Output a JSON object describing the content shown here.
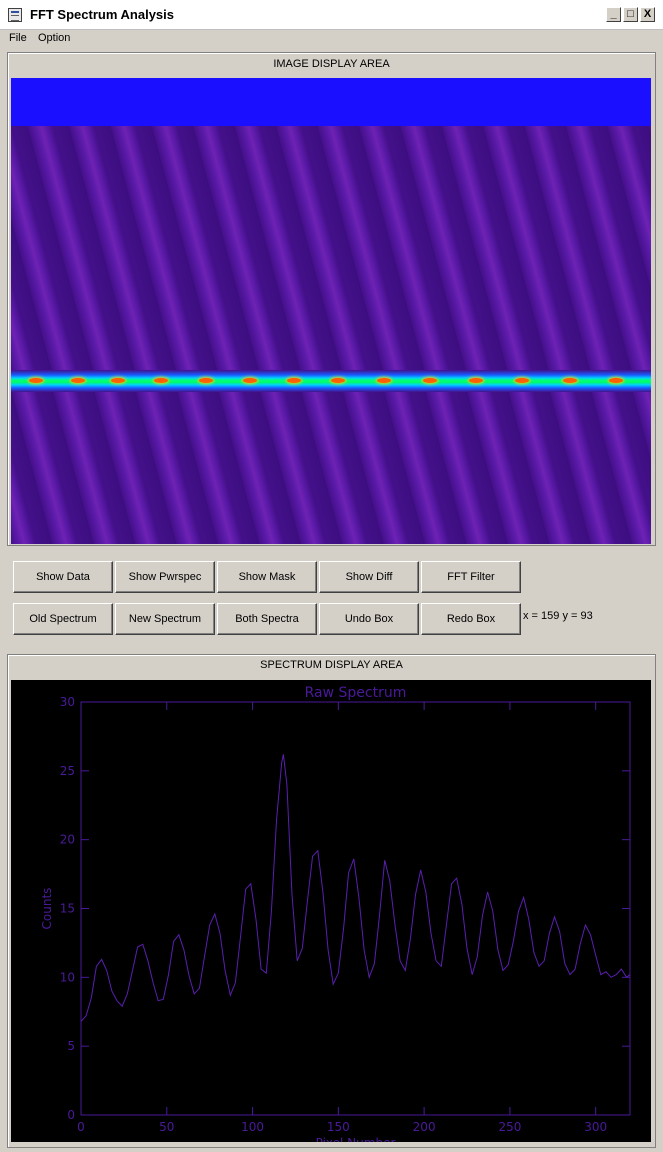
{
  "window": {
    "title": "FFT Spectrum Analysis",
    "minimize": "_",
    "maximize": "□",
    "close": "X"
  },
  "menu": [
    "File",
    "Option"
  ],
  "image_area": {
    "label": "IMAGE DISPLAY AREA"
  },
  "buttons_row1": [
    "Show Data",
    "Show Pwrspec",
    "Show Mask",
    "Show Diff",
    "FFT Filter"
  ],
  "buttons_row2": [
    "Old Spectrum",
    "New Spectrum",
    "Both Spectra",
    "Undo Box",
    "Redo Box"
  ],
  "cursor_readout": "x = 159 y =  93",
  "spectrum_area": {
    "label": "SPECTRUM DISPLAY AREA"
  },
  "colors": {
    "plot_line": "#5a1fb0",
    "plot_bg": "#000000",
    "axis": "#4a1a9a"
  },
  "chart_data": {
    "type": "line",
    "title": "Raw Spectrum",
    "xlabel": "Pixel Number",
    "ylabel": "Counts",
    "xlim": [
      0,
      320
    ],
    "ylim": [
      0,
      30
    ],
    "xticks": [
      0,
      50,
      100,
      150,
      200,
      250,
      300
    ],
    "yticks": [
      0,
      5,
      10,
      15,
      20,
      25,
      30
    ],
    "grid": false,
    "x": [
      0,
      3,
      6,
      9,
      12,
      15,
      18,
      21,
      24,
      27,
      30,
      33,
      36,
      39,
      42,
      45,
      48,
      51,
      54,
      57,
      60,
      63,
      66,
      69,
      72,
      75,
      78,
      81,
      84,
      87,
      90,
      93,
      96,
      99,
      102,
      105,
      108,
      111,
      114,
      117,
      118,
      120,
      123,
      126,
      129,
      132,
      135,
      138,
      141,
      144,
      147,
      150,
      153,
      156,
      159,
      162,
      165,
      168,
      171,
      174,
      177,
      180,
      183,
      186,
      189,
      192,
      195,
      198,
      201,
      204,
      207,
      210,
      213,
      216,
      219,
      222,
      225,
      228,
      231,
      234,
      237,
      240,
      243,
      246,
      249,
      252,
      255,
      258,
      261,
      264,
      267,
      270,
      273,
      276,
      279,
      282,
      285,
      288,
      291,
      294,
      297,
      300,
      303,
      306,
      309,
      312,
      315,
      318,
      320
    ],
    "y": [
      6.8,
      7.2,
      8.5,
      10.8,
      11.3,
      10.5,
      9.0,
      8.3,
      7.9,
      8.8,
      10.5,
      12.2,
      12.4,
      11.2,
      9.6,
      8.3,
      8.4,
      10.2,
      12.6,
      13.1,
      12.0,
      10.1,
      8.8,
      9.2,
      11.5,
      13.8,
      14.6,
      13.2,
      10.5,
      8.7,
      9.6,
      13.0,
      16.4,
      16.8,
      14.2,
      10.6,
      10.3,
      14.8,
      21.5,
      25.6,
      26.2,
      24.0,
      16.0,
      11.2,
      12.1,
      15.6,
      18.8,
      19.2,
      16.2,
      12.0,
      9.5,
      10.3,
      13.5,
      17.6,
      18.6,
      15.8,
      12.0,
      10.0,
      11.0,
      14.5,
      18.5,
      17.0,
      13.8,
      11.2,
      10.5,
      12.8,
      16.0,
      17.8,
      16.2,
      13.2,
      11.2,
      10.8,
      13.8,
      16.8,
      17.2,
      15.3,
      12.1,
      10.2,
      11.5,
      14.5,
      16.2,
      14.8,
      12.0,
      10.5,
      10.9,
      12.6,
      14.8,
      15.8,
      14.2,
      11.8,
      10.8,
      11.2,
      13.2,
      14.4,
      13.3,
      11.0,
      10.2,
      10.6,
      12.4,
      13.8,
      13.1,
      11.6,
      10.2,
      10.4,
      10.0,
      10.2,
      10.6,
      10.0,
      10.2
    ]
  }
}
